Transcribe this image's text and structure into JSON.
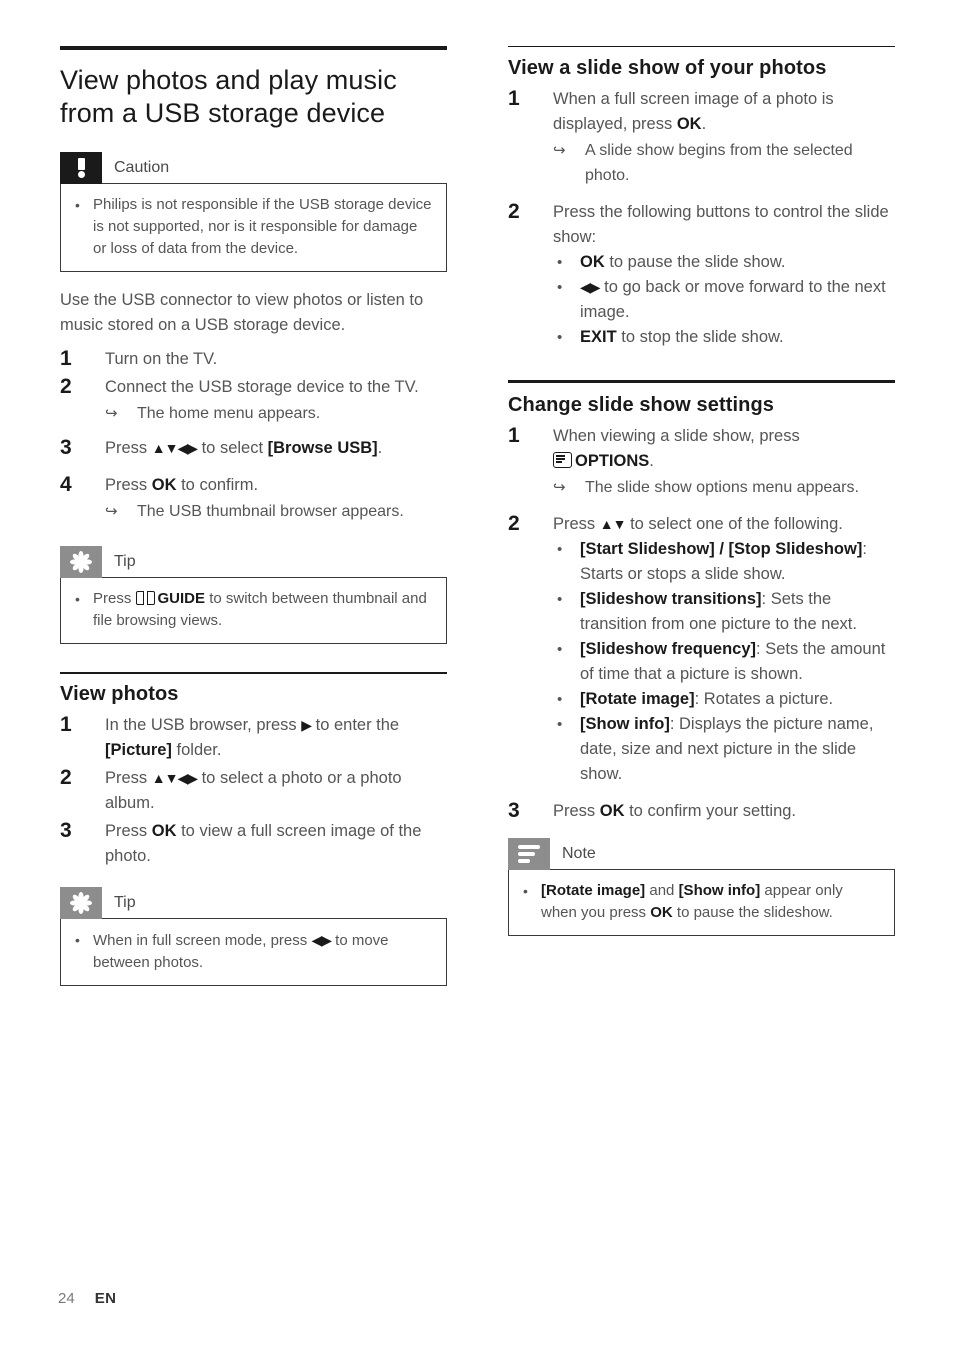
{
  "footer": {
    "page_number": "24",
    "language": "EN"
  },
  "left_column": {
    "chapter_title": "View photos and play music from a USB storage device",
    "caution": {
      "label": "Caution",
      "icon": "exclamation-icon",
      "items": [
        "Philips is not responsible if the USB storage device is not supported, nor is it responsible for damage or loss of data from the device."
      ]
    },
    "intro": "Use the USB connector to view photos or listen to music stored on a USB storage device.",
    "steps": [
      {
        "num": "1",
        "text": "Turn on the TV."
      },
      {
        "num": "2",
        "text": "Connect the USB storage device to the TV.",
        "result": "The home menu appears."
      },
      {
        "num": "3",
        "text_pre": "Press ",
        "arrows": "▲▼◀▶",
        "text_mid": " to select ",
        "bold": "[Browse USB]",
        "text_post": "."
      },
      {
        "num": "4",
        "text_pre": "Press ",
        "bold": "OK",
        "text_post": " to confirm.",
        "result": "The USB thumbnail browser appears."
      }
    ],
    "tip_1": {
      "label": "Tip",
      "icon": "tip-asterisk-icon",
      "item_pre": "Press ",
      "item_icon": "guide-book-icon",
      "item_bold": "GUIDE",
      "item_post": " to switch between thumbnail and file browsing views."
    },
    "view_photos": {
      "heading": "View photos",
      "steps": [
        {
          "num": "1",
          "text_pre": "In the USB browser, press ",
          "arrows": "▶",
          "text_mid": " to enter the ",
          "bold": "[Picture]",
          "text_post": " folder."
        },
        {
          "num": "2",
          "text_pre": "Press ",
          "arrows": "▲▼◀▶",
          "text_mid": " to select a photo or a photo album.",
          "bold": "",
          "text_post": ""
        },
        {
          "num": "3",
          "text_pre": "Press ",
          "bold": "OK",
          "text_post": " to view a full screen image of the photo."
        }
      ]
    },
    "tip_2": {
      "label": "Tip",
      "icon": "tip-asterisk-icon",
      "item_pre": "When in full screen mode, press ",
      "item_arrows": "◀▶",
      "item_post": " to move between photos."
    }
  },
  "right_column": {
    "slide_show": {
      "heading": "View a slide show of your photos",
      "step1": {
        "num": "1",
        "text_pre": "When a full screen image of a photo is displayed, press ",
        "bold": "OK",
        "text_post": ".",
        "result": "A slide show begins from the selected photo."
      },
      "step2": {
        "num": "2",
        "text": "Press the following buttons to control the slide show:",
        "bullets": [
          {
            "bold": "OK",
            "text": " to pause the slide show."
          },
          {
            "arrows": "◀▶",
            "text": " to go back or move forward to the next image."
          },
          {
            "bold": "EXIT",
            "text": " to stop the slide show."
          }
        ]
      }
    },
    "settings": {
      "heading": "Change slide show settings",
      "step1": {
        "num": "1",
        "text_pre": "When viewing a slide show, press",
        "icon": "options-icon",
        "bold": "OPTIONS",
        "text_post": ".",
        "result": "The slide show options menu appears."
      },
      "step2": {
        "num": "2",
        "text_pre": "Press ",
        "arrows": "▲▼",
        "text_post": " to select one of the following.",
        "bullets": [
          {
            "bold": "[Start Slideshow] / [Stop Slideshow]",
            "text": ": Starts or stops a slide show."
          },
          {
            "bold": "[Slideshow transitions]",
            "text": ": Sets the transition from one picture to the next."
          },
          {
            "bold": "[Slideshow frequency]",
            "text": ": Sets the amount of time that a picture is shown."
          },
          {
            "bold": "[Rotate image]",
            "text": ": Rotates a picture."
          },
          {
            "bold": "[Show info]",
            "text": ": Displays the picture name, date, size and next picture in the slide show."
          }
        ]
      },
      "step3": {
        "num": "3",
        "text_pre": "Press ",
        "bold": "OK",
        "text_post": " to confirm your setting."
      }
    },
    "note": {
      "label": "Note",
      "icon": "note-lines-icon",
      "item_bold_1": "[Rotate image]",
      "item_mid_1": " and ",
      "item_bold_2": "[Show info]",
      "item_mid_2": " appear only when you press ",
      "item_bold_3": "OK",
      "item_post": " to pause the slideshow."
    }
  }
}
